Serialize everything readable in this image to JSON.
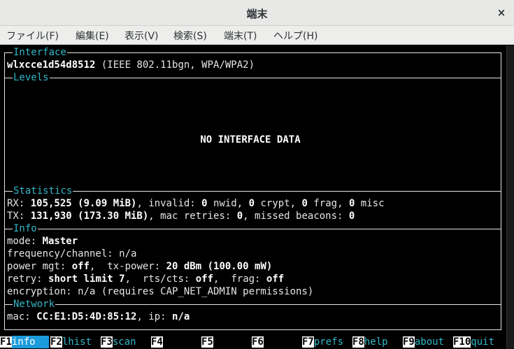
{
  "window": {
    "title": "端末",
    "close_glyph": "×"
  },
  "menubar": [
    {
      "label": "ファイル(F)"
    },
    {
      "label": "編集(E)"
    },
    {
      "label": "表示(V)"
    },
    {
      "label": "検索(S)"
    },
    {
      "label": "端末(T)"
    },
    {
      "label": "ヘルプ(H)"
    }
  ],
  "sections": {
    "interface": "Interface",
    "levels": "Levels",
    "statistics": "Statistics",
    "info": "Info",
    "network": "Network"
  },
  "interface": {
    "name": "wlxcce1d54d8512",
    "desc": " (IEEE 802.11bgn, WPA/WPA2)"
  },
  "levels": {
    "message": "NO INTERFACE DATA"
  },
  "statistics": {
    "rx_label": "RX: ",
    "rx_value": "105,525 (9.09 MiB)",
    "rx_invalid_label": ", invalid: ",
    "rx_invalid": "0",
    "rx_nwid_label": " nwid, ",
    "rx_crypt": "0",
    "rx_crypt_label": " crypt, ",
    "rx_frag": "0",
    "rx_frag_label": " frag, ",
    "rx_misc": "0",
    "rx_misc_label": " misc",
    "tx_label": "TX: ",
    "tx_value": "131,930 (173.30 MiB)",
    "tx_retries_label": ", mac retries: ",
    "tx_retries": "0",
    "tx_missed_label": ", missed beacons: ",
    "tx_missed": "0"
  },
  "info": {
    "mode_label": "mode: ",
    "mode_value": "Master",
    "freq_line": "frequency/channel: n/a",
    "power_label": "power mgt: ",
    "power_value": "off",
    "txpower_label": ",  tx-power: ",
    "txpower_value": "20 dBm (100.00 mW)",
    "retry_label": "retry: ",
    "retry_value": "short limit 7",
    "rts_label": ",  rts/cts: ",
    "rts_value": "off",
    "frag_label": ",  frag: ",
    "frag_value": "off",
    "encryption_line": "encryption: n/a (requires CAP_NET_ADMIN permissions)"
  },
  "network": {
    "mac_label": "mac: ",
    "mac_value": "CC:E1:D5:4D:85:12",
    "ip_label": ", ip: ",
    "ip_value": "n/a"
  },
  "function_keys": [
    {
      "key": "F1",
      "label": "info"
    },
    {
      "key": "F2",
      "label": "lhist"
    },
    {
      "key": "F3",
      "label": "scan"
    },
    {
      "key": "F4",
      "label": ""
    },
    {
      "key": "F5",
      "label": ""
    },
    {
      "key": "F6",
      "label": ""
    },
    {
      "key": "F7",
      "label": "prefs"
    },
    {
      "key": "F8",
      "label": "help"
    },
    {
      "key": "F9",
      "label": "about"
    },
    {
      "key": "F10",
      "label": "quit"
    }
  ],
  "colors": {
    "section_title": "#32b7c8",
    "active_fkey_bg": "#1c9bdc",
    "terminal_bg": "#000000"
  }
}
